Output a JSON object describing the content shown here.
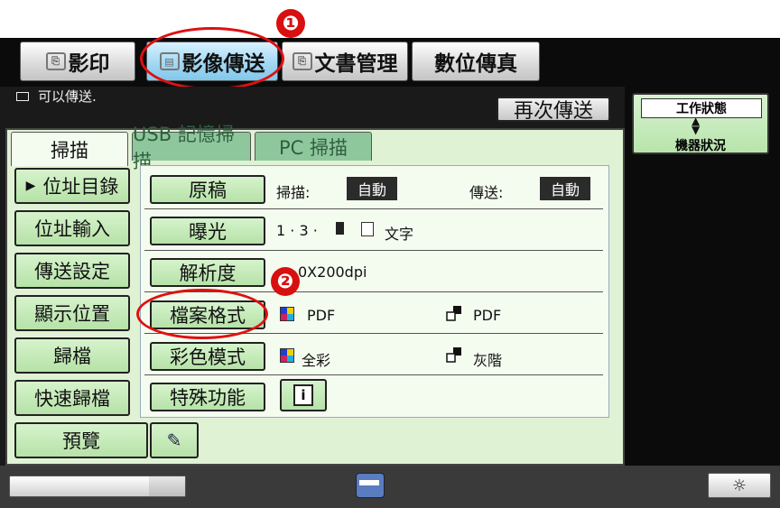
{
  "top_tabs": [
    {
      "label": "影印",
      "icon": "copy-icon"
    },
    {
      "label": "影像傳送",
      "icon": "scanner-icon"
    },
    {
      "label": "文書管理",
      "icon": "document-icon"
    },
    {
      "label": "數位傳真",
      "icon": ""
    }
  ],
  "status": {
    "icon": "envelope-icon",
    "text": "可以傳送.",
    "resend_label": "再次傳送"
  },
  "sub_tabs": [
    "掃描",
    "USB 記憶掃描",
    "PC 掃描"
  ],
  "left_menu": [
    "位址目錄",
    "位址輸入",
    "傳送設定",
    "顯示位置",
    "歸檔",
    "快速歸檔",
    "預覽"
  ],
  "settings": {
    "original": {
      "label": "原稿",
      "scan_label": "掃描:",
      "scan_value": "自動",
      "send_label": "傳送:",
      "send_value": "自動"
    },
    "exposure": {
      "label": "曝光",
      "value": "1 · 3 · ",
      "mode": "文字"
    },
    "resolution": {
      "label": "解析度",
      "value": "0X200dpi"
    },
    "file_format": {
      "label": "檔案格式",
      "color_value": "PDF",
      "bw_value": "PDF"
    },
    "color_mode": {
      "label": "彩色模式",
      "color_value": "全彩",
      "bw_value": "灰階"
    },
    "special": {
      "label": "特殊功能",
      "info_glyph": "i"
    }
  },
  "right_panel": {
    "job_status": "工作狀態",
    "machine_status": "機器狀況"
  },
  "callouts": [
    "❶",
    "❷"
  ],
  "colors": {
    "accent_red": "#e01010",
    "tab_active": "#9fd6f2",
    "green_button": "#b6e2a8",
    "panel_bg": "#e0f2d4"
  }
}
